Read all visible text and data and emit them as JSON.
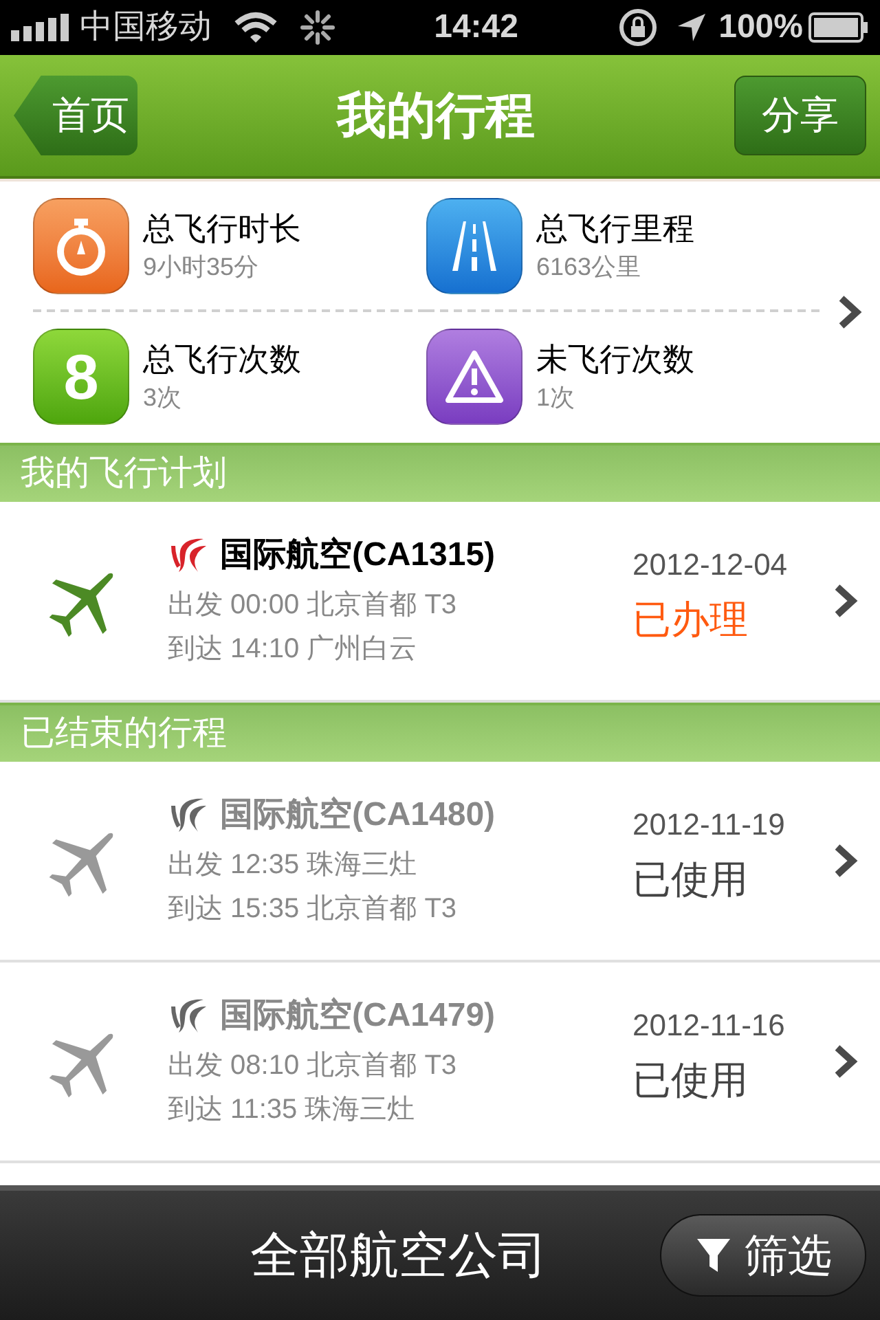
{
  "status_bar": {
    "carrier": "中国移动",
    "time": "14:42",
    "battery": "100%"
  },
  "nav_bar": {
    "back": "首页",
    "title": "我的行程",
    "action": "分享"
  },
  "stats": [
    {
      "kind": "timer",
      "label": "总飞行时长",
      "value": "9小时35分"
    },
    {
      "kind": "road",
      "label": "总飞行里程",
      "value": "6163公里"
    },
    {
      "kind": "count",
      "icon_text": "8",
      "label": "总飞行次数",
      "value": "3次"
    },
    {
      "kind": "warning",
      "label": "未飞行次数",
      "value": "1次"
    }
  ],
  "sections": [
    {
      "title": "我的飞行计划",
      "flights": [
        {
          "completed": false,
          "airline": "国际航空(CA1315)",
          "depart": "出发 00:00 北京首都 T3",
          "arrive": "到达 14:10 广州白云",
          "date": "2012-12-04",
          "status": "已办理"
        }
      ]
    },
    {
      "title": "已结束的行程",
      "flights": [
        {
          "completed": true,
          "airline": "国际航空(CA1480)",
          "depart": "出发 12:35 珠海三灶",
          "arrive": "到达 15:35 北京首都 T3",
          "date": "2012-11-19",
          "status": "已使用"
        },
        {
          "completed": true,
          "airline": "国际航空(CA1479)",
          "depart": "出发 08:10 北京首都 T3",
          "arrive": "到达 11:35 珠海三灶",
          "date": "2012-11-16",
          "status": "已使用"
        }
      ]
    }
  ],
  "bottom_bar": {
    "title": "全部航空公司",
    "filter": "筛选"
  }
}
